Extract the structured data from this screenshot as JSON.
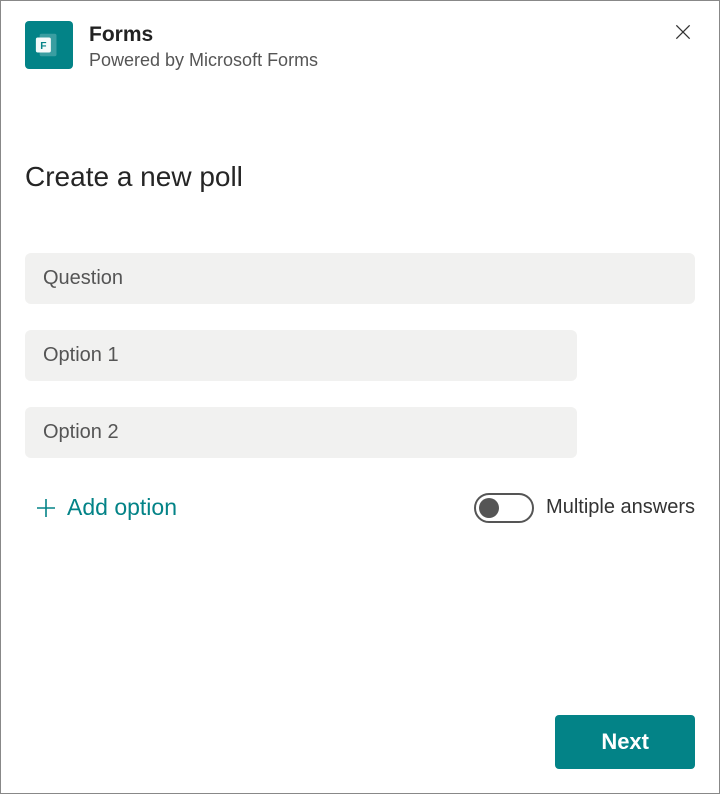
{
  "header": {
    "app_title": "Forms",
    "app_subtitle": "Powered by Microsoft Forms",
    "icon_name": "forms-icon",
    "icon_color": "#038387"
  },
  "page": {
    "title": "Create a new poll"
  },
  "fields": {
    "question_placeholder": "Question",
    "options": [
      {
        "placeholder": "Option 1"
      },
      {
        "placeholder": "Option 2"
      }
    ]
  },
  "controls": {
    "add_option_label": "Add option",
    "multiple_answers_label": "Multiple answers",
    "multiple_answers_on": false
  },
  "footer": {
    "next_label": "Next"
  },
  "colors": {
    "accent": "#038387",
    "field_bg": "#f1f1f0"
  }
}
